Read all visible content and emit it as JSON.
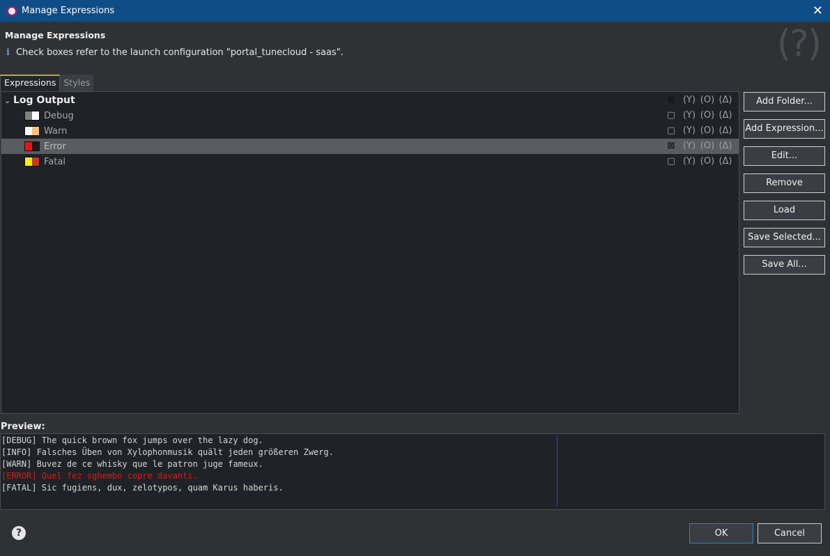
{
  "window": {
    "title": "Manage Expressions"
  },
  "header": {
    "title": "Manage Expressions",
    "info_text": "Check boxes refer to the launch configuration \"portal_tunecloud - saas\".",
    "help_glyph": "(?)"
  },
  "tabs": [
    {
      "label": "Expressions",
      "active": true
    },
    {
      "label": "Styles",
      "active": false
    }
  ],
  "tree": {
    "folder": {
      "label": "Log Output",
      "expanded": true,
      "flags": [
        "⊠",
        "(Y)",
        "(O)",
        "(Δ)"
      ]
    },
    "items": [
      {
        "label": "Debug",
        "colors": [
          "#808080",
          "#ffffff"
        ],
        "flags": [
          "▢",
          "(Y)",
          "(O)",
          "(Δ)"
        ],
        "selected": false
      },
      {
        "label": "Warn",
        "colors": [
          "#ffffff",
          "#f4c07a"
        ],
        "flags": [
          "▢",
          "(Y)",
          "(O)",
          "(Δ)"
        ],
        "selected": false
      },
      {
        "label": "Error",
        "colors": [
          "#ee1111",
          "#1a1a1a"
        ],
        "flags": [
          "⊠",
          "(Y)",
          "(O)",
          "(Δ)"
        ],
        "selected": true
      },
      {
        "label": "Fatal",
        "colors": [
          "#ffee11",
          "#c0392b"
        ],
        "flags": [
          "▢",
          "(Y)",
          "(O)",
          "(Δ)"
        ],
        "selected": false
      }
    ]
  },
  "side_buttons": {
    "add_folder": "Add Folder...",
    "add_expression": "Add Expression...",
    "edit": "Edit...",
    "remove": "Remove",
    "load": "Load",
    "save_selected": "Save Selected...",
    "save_all": "Save All..."
  },
  "preview": {
    "label": "Preview:",
    "lines": [
      {
        "text": "[DEBUG] The quick brown fox jumps over the lazy dog.",
        "error": false
      },
      {
        "text": "[INFO] Falsches Üben von Xylophonmusik quält jeden größeren Zwerg.",
        "error": false
      },
      {
        "text": "[WARN] Buvez de ce whisky que le patron juge fameux.",
        "error": false
      },
      {
        "text": "[ERROR] Quel fez sghembo copre davanti.",
        "error": true
      },
      {
        "text": "[FATAL] Sic fugiens, dux, zelotypos, quam Karus haberis.",
        "error": false
      }
    ]
  },
  "footer": {
    "ok": "OK",
    "cancel": "Cancel",
    "help": "?"
  }
}
